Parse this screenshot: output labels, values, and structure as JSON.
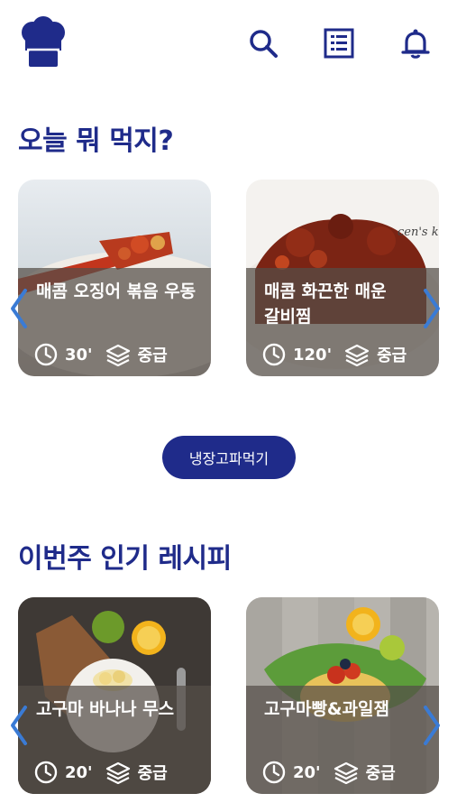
{
  "header": {
    "logo_icon": "chef-hat-icon",
    "icons": [
      "search-icon",
      "list-icon",
      "bell-icon"
    ]
  },
  "sections": [
    {
      "title": "오늘 뭐 먹지?",
      "cards": [
        {
          "title": "매콤 오징어 볶음 우동",
          "time": "30'",
          "level": "중급"
        },
        {
          "title": "매콤 화끈한 매운 갈비찜",
          "time": "120'",
          "level": "중급",
          "photo_text": "cen's k"
        }
      ]
    },
    {
      "title": "이번주 인기 레시피",
      "cards": [
        {
          "title": "고구마 바나나 무스",
          "time": "20'",
          "level": "중급"
        },
        {
          "title": "고구마빵&과일잼",
          "time": "20'",
          "level": "중급"
        }
      ]
    }
  ],
  "fridge_button": {
    "label": "냉장고파먹기"
  },
  "colors": {
    "primary": "#1f2b8a",
    "chevron": "#3a7bd5",
    "overlay": "#554e48"
  }
}
